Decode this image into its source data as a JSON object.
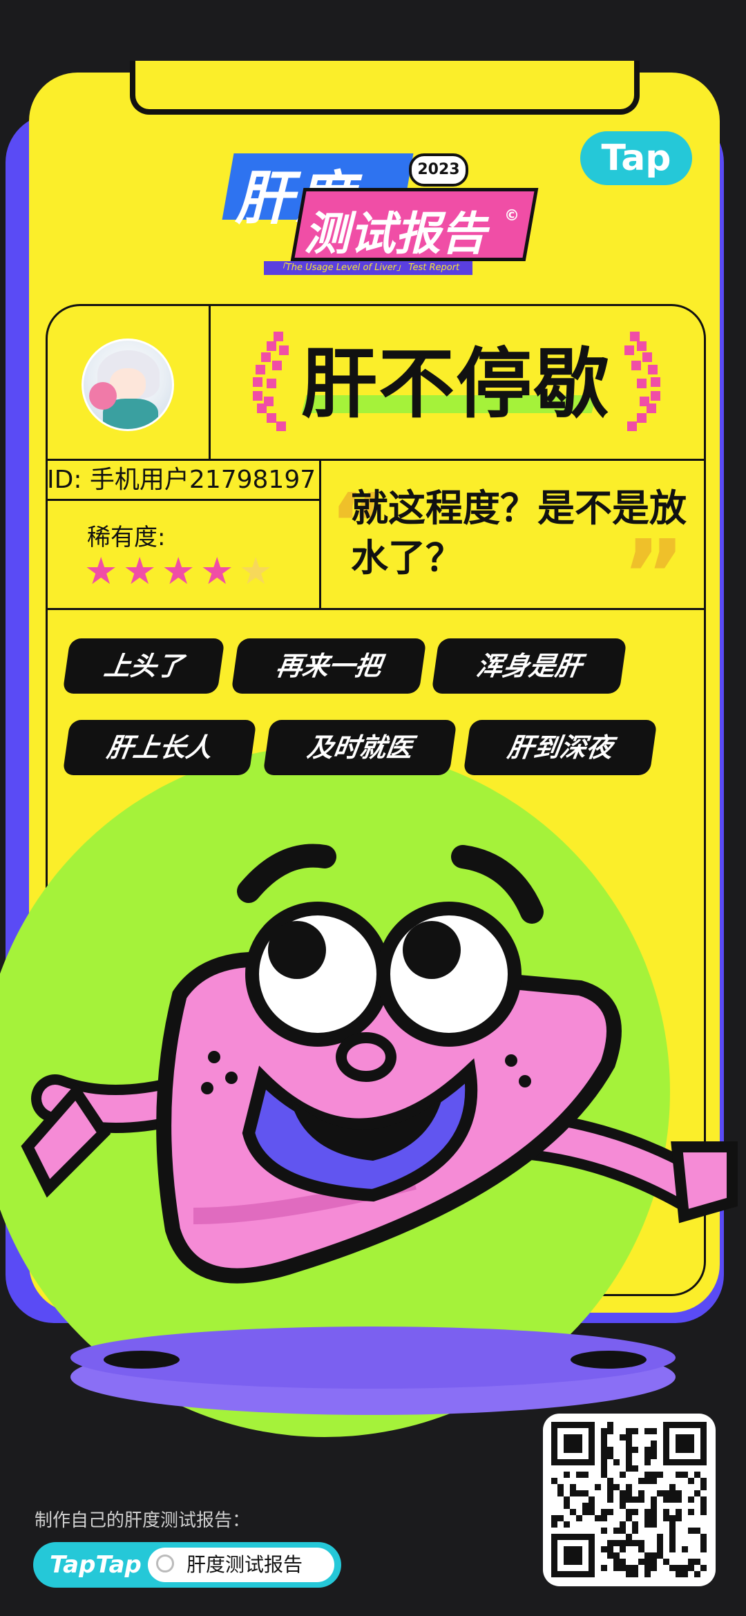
{
  "header": {
    "title_line1": "肝度",
    "year": "2023",
    "title_line2": "测试报告",
    "subtitle": "「The Usage Level of Liver」 Test Report",
    "brand_logo": "Tap"
  },
  "profile": {
    "badge_title": "肝不停歇",
    "user_id": "ID: 手机用户21798197",
    "rarity_label": "稀有度:",
    "rarity_stars": 4,
    "rarity_max": 5,
    "quote": "就这程度？是不是放水了？"
  },
  "tags": [
    "上头了",
    "再来一把",
    "浑身是肝",
    "肝上长人",
    "及时就医",
    "肝到深夜"
  ],
  "footer": {
    "cta_text": "制作自己的肝度测试报告：",
    "search_brand": "TapTap",
    "search_query": "肝度测试报告"
  },
  "colors": {
    "background": "#1b1b1d",
    "card": "#fbee2a",
    "shadow": "#5a4bf5",
    "accent_pink": "#f04ea6",
    "accent_green": "#a5f23a",
    "brand_cyan": "#25c8d8"
  },
  "icons": {
    "star": "star-icon",
    "laurel": "laurel-icon",
    "search": "search-icon",
    "qr": "qr-code"
  }
}
